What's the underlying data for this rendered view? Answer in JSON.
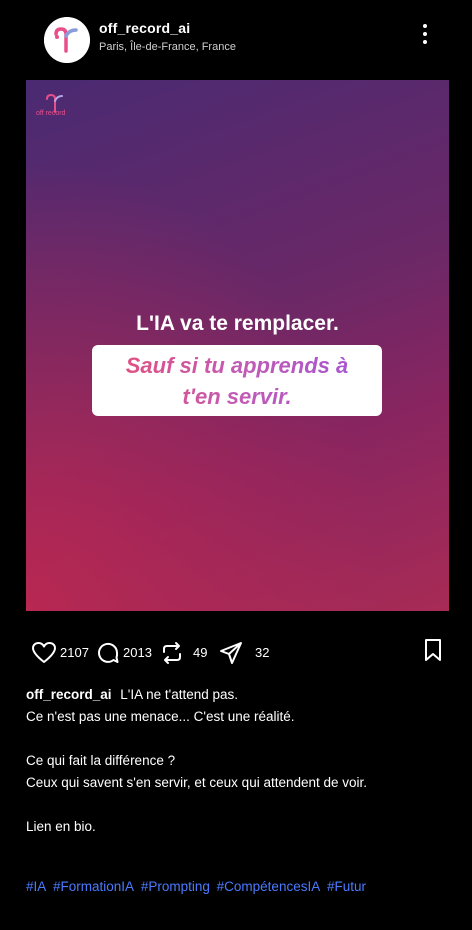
{
  "header": {
    "username": "off_record_ai",
    "location": "Paris, Île-de-France, France"
  },
  "post": {
    "logo_text": "off record",
    "headline": "L'IA va te remplacer.",
    "callout_line1": "Sauf si tu apprends à",
    "callout_line2": "t'en servir."
  },
  "actions": {
    "likes": "2107",
    "comments": "2013",
    "reposts": "49",
    "shares": "32"
  },
  "caption": {
    "username": "off_record_ai",
    "line1": "L'IA ne t'attend pas.",
    "line2": "Ce n'est pas une menace... C'est une réalité.",
    "line3": "Ce qui fait la différence ?",
    "line4": "Ceux qui savent s'en servir, et ceux qui attendent de voir.",
    "line5": "Lien en bio.",
    "hashtags": [
      "#IA",
      "#FormationIA",
      "#Prompting",
      "#CompétencesIA",
      "#Futur"
    ]
  },
  "colors": {
    "background": "#000000",
    "hashtag": "#4a7bff",
    "brand_pink": "#e84f8a"
  }
}
